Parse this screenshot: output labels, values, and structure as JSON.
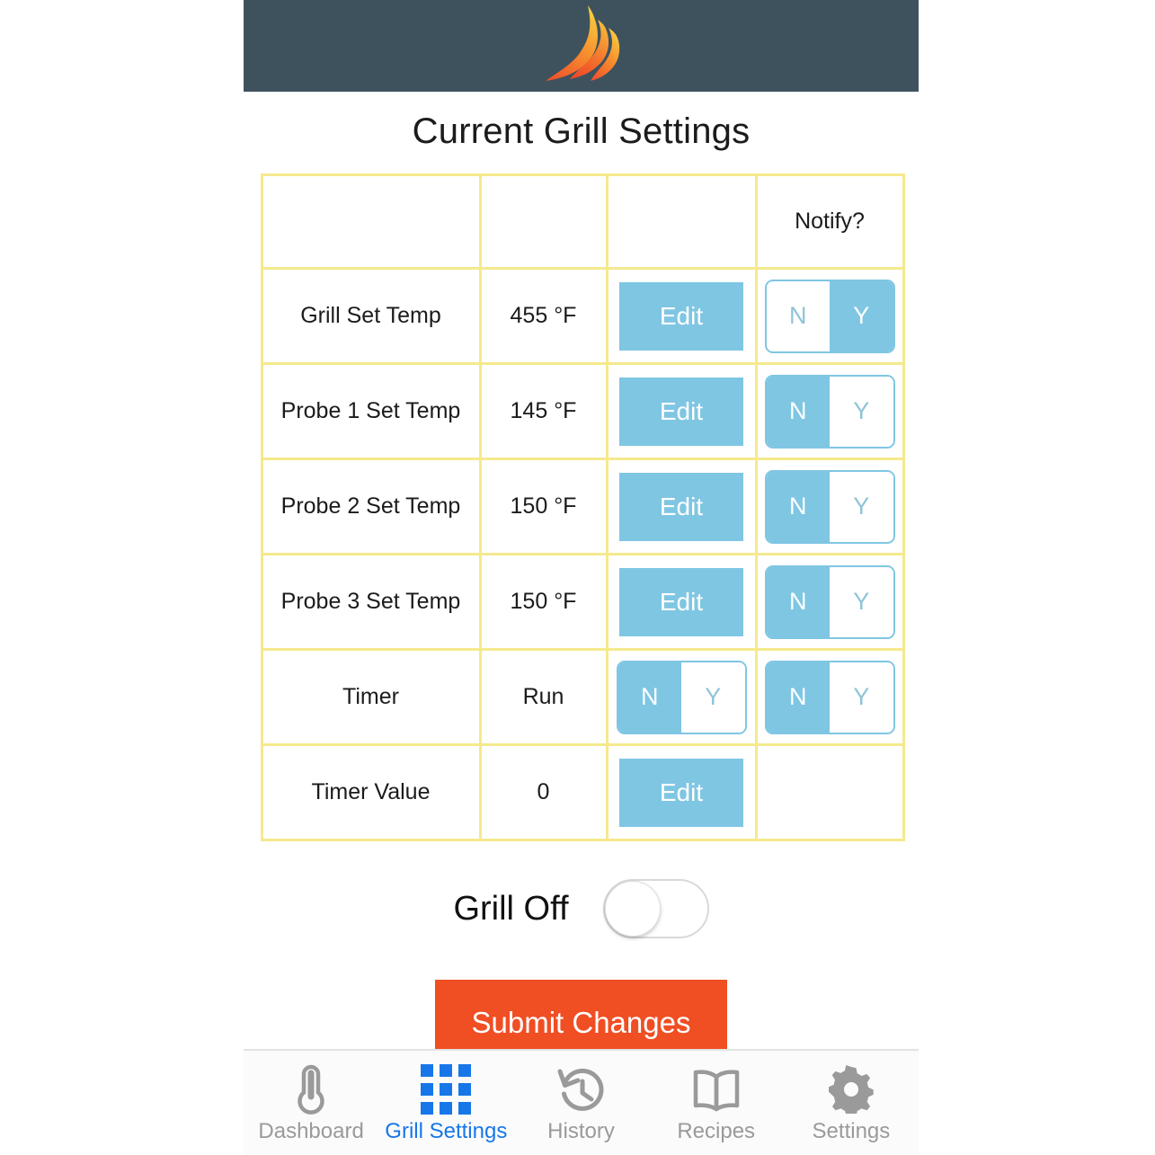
{
  "header": {
    "logo_icon": "flame-icon",
    "background_color": "#3e525e",
    "flame_color_top": "#f9c23c",
    "flame_color_bottom": "#f0512a"
  },
  "page_title": "Current Grill Settings",
  "table": {
    "columns": [
      "",
      "",
      "",
      "Notify?"
    ],
    "border_color": "#f5e98d",
    "rows": [
      {
        "label": "Grill Set Temp",
        "value": "455 °F",
        "action": {
          "type": "button",
          "label": "Edit"
        },
        "notify": {
          "type": "segmented",
          "options": [
            "N",
            "Y"
          ],
          "selected": "Y"
        }
      },
      {
        "label": "Probe 1 Set Temp",
        "value": "145 °F",
        "action": {
          "type": "button",
          "label": "Edit"
        },
        "notify": {
          "type": "segmented",
          "options": [
            "N",
            "Y"
          ],
          "selected": "N"
        }
      },
      {
        "label": "Probe 2 Set Temp",
        "value": "150 °F",
        "action": {
          "type": "button",
          "label": "Edit"
        },
        "notify": {
          "type": "segmented",
          "options": [
            "N",
            "Y"
          ],
          "selected": "N"
        }
      },
      {
        "label": "Probe 3 Set Temp",
        "value": "150 °F",
        "action": {
          "type": "button",
          "label": "Edit"
        },
        "notify": {
          "type": "segmented",
          "options": [
            "N",
            "Y"
          ],
          "selected": "N"
        }
      },
      {
        "label": "Timer",
        "value": "Run",
        "action": {
          "type": "segmented",
          "options": [
            "N",
            "Y"
          ],
          "selected": "N"
        },
        "notify": {
          "type": "segmented",
          "options": [
            "N",
            "Y"
          ],
          "selected": "N"
        }
      },
      {
        "label": "Timer Value",
        "value": "0",
        "action": {
          "type": "button",
          "label": "Edit"
        },
        "notify": {
          "type": "empty"
        }
      }
    ]
  },
  "grill_power": {
    "label": "Grill Off",
    "switch_state": "off"
  },
  "submit": {
    "label": "Submit Changes",
    "color": "#f04e23"
  },
  "bottom_nav": {
    "active_color": "#1777e8",
    "inactive_color": "#9a9a9a",
    "items": [
      {
        "label": "Dashboard",
        "icon": "thermometer-icon",
        "active": false
      },
      {
        "label": "Grill Settings",
        "icon": "grid-icon",
        "active": true
      },
      {
        "label": "History",
        "icon": "clock-history-icon",
        "active": false
      },
      {
        "label": "Recipes",
        "icon": "book-icon",
        "active": false
      },
      {
        "label": "Settings",
        "icon": "gear-icon",
        "active": false
      }
    ]
  },
  "colors": {
    "accent_blue": "#7fc6e3",
    "table_border": "#f5e98d",
    "submit_orange": "#f04e23",
    "header_slate": "#3e525e"
  }
}
